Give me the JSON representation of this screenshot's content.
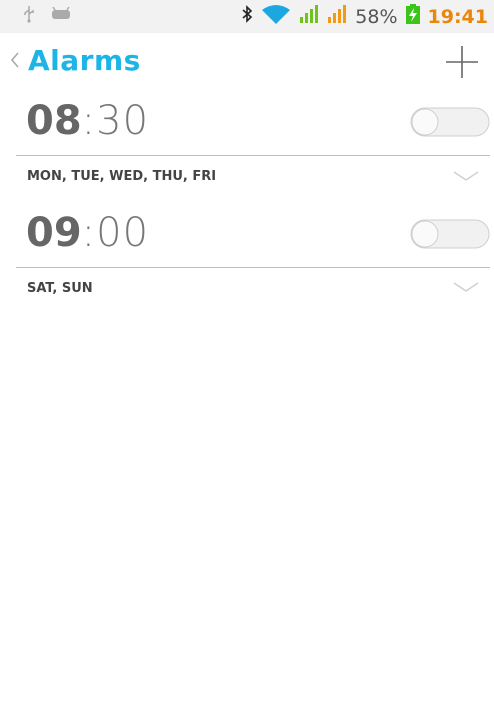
{
  "status_bar": {
    "icons": [
      "usb-icon",
      "android-debug-icon",
      "bluetooth-icon",
      "wifi-icon",
      "signal-1-icon",
      "signal-2-icon",
      "battery-charging-icon"
    ],
    "battery_percent": "58%",
    "time": "19:41",
    "colors": {
      "wifi": "#1ca7e0",
      "signal1": "#6fc41a",
      "signal2": "#f29a14",
      "battery": "#3cc41a",
      "time": "#e8870a"
    }
  },
  "app_bar": {
    "title": "Alarms",
    "back_icon": "chevron-left-icon",
    "add_icon": "plus-icon",
    "accent_color": "#1cb5e6"
  },
  "alarms": [
    {
      "hour": "08",
      "separator": ":",
      "minute": "30",
      "days": "MON, TUE, WED, THU, FRI",
      "enabled": false
    },
    {
      "hour": "09",
      "separator": ":",
      "minute": "00",
      "days": "SAT, SUN",
      "enabled": false
    }
  ]
}
